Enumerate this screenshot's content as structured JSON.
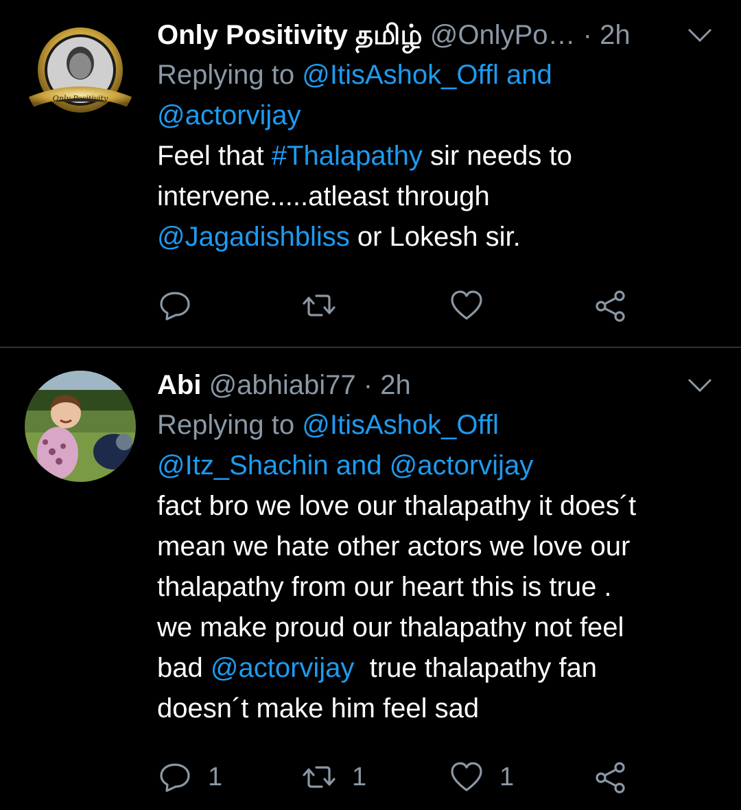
{
  "colors": {
    "background": "#000000",
    "text_primary": "#ffffff",
    "text_secondary": "#8b98a5",
    "link": "#1d9bf0",
    "divider": "#2f3336"
  },
  "tweets": [
    {
      "avatar_icon": "avatar-only-positivity",
      "avatar_caption": "Only Positivity",
      "display_name": "Only Positivity தமிழ்",
      "handle": "@OnlyPo…",
      "separator": "·",
      "time": "2h",
      "replying_prefix": "Replying to",
      "reply_mention_1": "@ItisAshok_Offl",
      "reply_and": "and",
      "reply_mention_2": "@actorvijay",
      "body": {
        "l1_a": "Feel that ",
        "l1_hashtag": "#Thalapathy",
        "l1_b": " sir needs to",
        "l2": "intervene.....atleast through",
        "l3_mention": "@Jagadishbliss",
        "l3_b": " or Lokesh sir."
      },
      "actions": {
        "reply_icon": "reply-icon",
        "retweet_icon": "retweet-icon",
        "like_icon": "heart-icon",
        "share_icon": "share-icon"
      }
    },
    {
      "avatar_icon": "avatar-abi",
      "display_name": "Abi",
      "handle": "@abhiabi77",
      "separator": "·",
      "time": "2h",
      "replying_prefix": "Replying to",
      "reply_mention_1": "@ItisAshok_Offl",
      "reply_mention_2": "@Itz_Shachin",
      "reply_and": "and",
      "reply_mention_3": "@actorvijay",
      "body": {
        "l1": "fact bro we love our thalapathy it does´t",
        "l2": "mean we hate other actors we love our",
        "l3": "thalapathy from our heart this is true .",
        "l4": "we make proud our thalapathy not feel",
        "l5_a": "bad ",
        "l5_mention": "@actorvijay",
        "l5_b": "  true thalapathy fan",
        "l6": "doesn´t make him feel sad"
      },
      "actions": {
        "reply_count": "1",
        "retweet_count": "1",
        "like_count": "1"
      }
    }
  ]
}
